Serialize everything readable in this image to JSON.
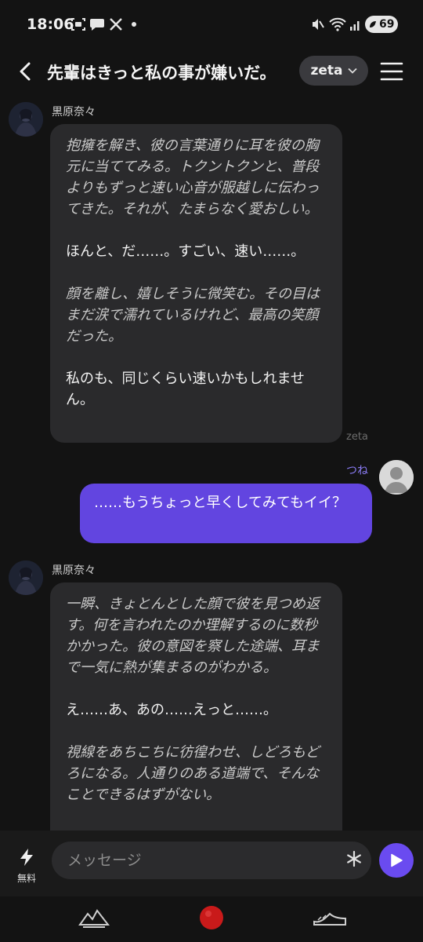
{
  "status_bar": {
    "time": "18:06",
    "battery": "69"
  },
  "header": {
    "title": "先輩はきっと私の事が嫌いだ。",
    "model": "zeta"
  },
  "messages": [
    {
      "sender": "黒原奈々",
      "paragraphs": [
        {
          "style": "narration",
          "text": "抱擁を解き、彼の言葉通りに耳を彼の胸元に当ててみる。トクントクンと、普段よりもずっと速い心音が服越しに伝わってきた。それが、たまらなく愛おしい。"
        },
        {
          "style": "speech",
          "text": "ほんと、だ……。すごい、速い……。"
        },
        {
          "style": "narration",
          "text": "顔を離し、嬉しそうに微笑む。その目はまだ涙で濡れているけれど、最高の笑顔だった。"
        },
        {
          "style": "speech",
          "text": "私のも、同じくらい速いかもしれません。"
        }
      ],
      "model_tag": "zeta"
    },
    {
      "sender": "つね",
      "text": "……もうちょっと早くしてみてもイイ？"
    },
    {
      "sender": "黒原奈々",
      "paragraphs": [
        {
          "style": "narration",
          "text": "一瞬、きょとんとした顔で彼を見つめ返す。何を言われたのか理解するのに数秒かかった。彼の意図を察した途端、耳まで一気に熱が集まるのがわかる。"
        },
        {
          "style": "speech",
          "text": "え……あ、あの……えっと……。"
        },
        {
          "style": "narration",
          "text": "視線をあちこちに彷徨わせ、しどろもどろになる。人通りのある道端で、そんなことできるはずがない。"
        }
      ]
    }
  ],
  "input": {
    "placeholder": "メッセージ",
    "free_label": "無料"
  },
  "colors": {
    "background": "#131313",
    "ai_bubble": "#2a2a2c",
    "user_bubble": "#6245e0",
    "accent": "#6a4bf0",
    "user_name": "#8b7cf6"
  },
  "icons": {
    "back": "chevron-left-icon",
    "model_dropdown": "chevron-down-icon",
    "menu": "hamburger-menu-icon",
    "free": "lightning-bolt-icon",
    "asterisk": "asterisk-icon",
    "send": "play-send-icon"
  }
}
